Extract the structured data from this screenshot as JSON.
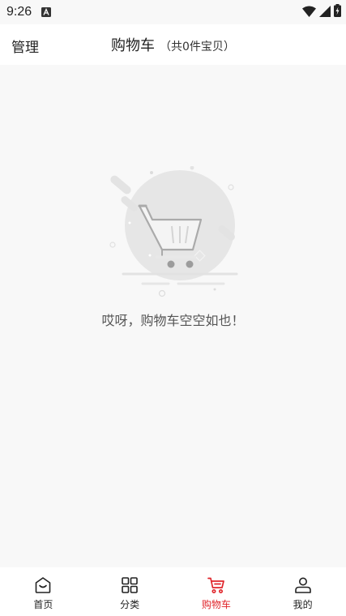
{
  "status_bar": {
    "time": "9:26",
    "notification_icon": "keyboard-icon",
    "icons": [
      "wifi-icon",
      "signal-icon",
      "battery-charging-icon"
    ]
  },
  "header": {
    "manage_label": "管理",
    "title": "购物车",
    "count_text": "（共0件宝贝）"
  },
  "empty_state": {
    "icon": "empty-cart-illustration",
    "message": "哎呀，购物车空空如也！"
  },
  "tabbar": {
    "active_color": "#e0252b",
    "items": [
      {
        "label": "首页",
        "icon": "home-icon"
      },
      {
        "label": "分类",
        "icon": "category-grid-icon"
      },
      {
        "label": "购物车",
        "icon": "cart-icon",
        "active": true
      },
      {
        "label": "我的",
        "icon": "profile-icon"
      }
    ]
  }
}
